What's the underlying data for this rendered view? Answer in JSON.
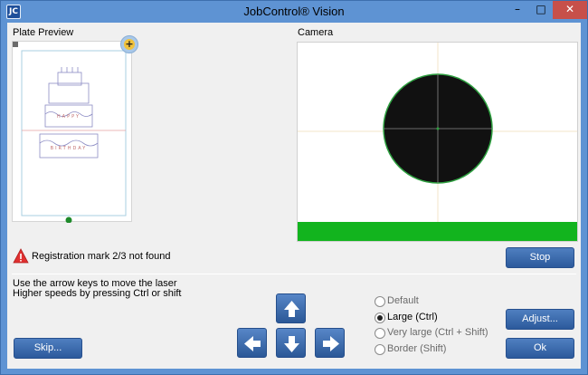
{
  "window": {
    "title": "JobControl® Vision",
    "app_icon_text": "JC",
    "controls": {
      "minimize": "–",
      "maximize": "□",
      "close": "✕"
    }
  },
  "plate_preview": {
    "label": "Plate Preview",
    "cake_top_letters": "HAPPY",
    "cake_bottom_letters": "BIRTHDAY"
  },
  "camera": {
    "label": "Camera"
  },
  "status": {
    "message": "Registration mark 2/3 not found",
    "icon": "warning-icon",
    "color": "#e03030"
  },
  "instructions": {
    "line1": "Use the arrow keys to move the laser",
    "line2": "Higher speeds by pressing Ctrl or shift"
  },
  "arrows": [
    "arrow-up-icon",
    "arrow-left-icon",
    "arrow-down-icon",
    "arrow-right-icon"
  ],
  "step_options": [
    {
      "label": "Default",
      "checked": false
    },
    {
      "label": "Large (Ctrl)",
      "checked": true
    },
    {
      "label": "Very large (Ctrl + Shift)",
      "checked": false
    },
    {
      "label": "Border (Shift)",
      "checked": false
    }
  ],
  "buttons": {
    "stop": "Stop",
    "adjust": "Adjust...",
    "ok": "Ok",
    "skip": "Skip..."
  },
  "colors": {
    "accent_button": "#3a69ad",
    "camera_progress": "#12b41e",
    "target_circle": "#111111"
  }
}
